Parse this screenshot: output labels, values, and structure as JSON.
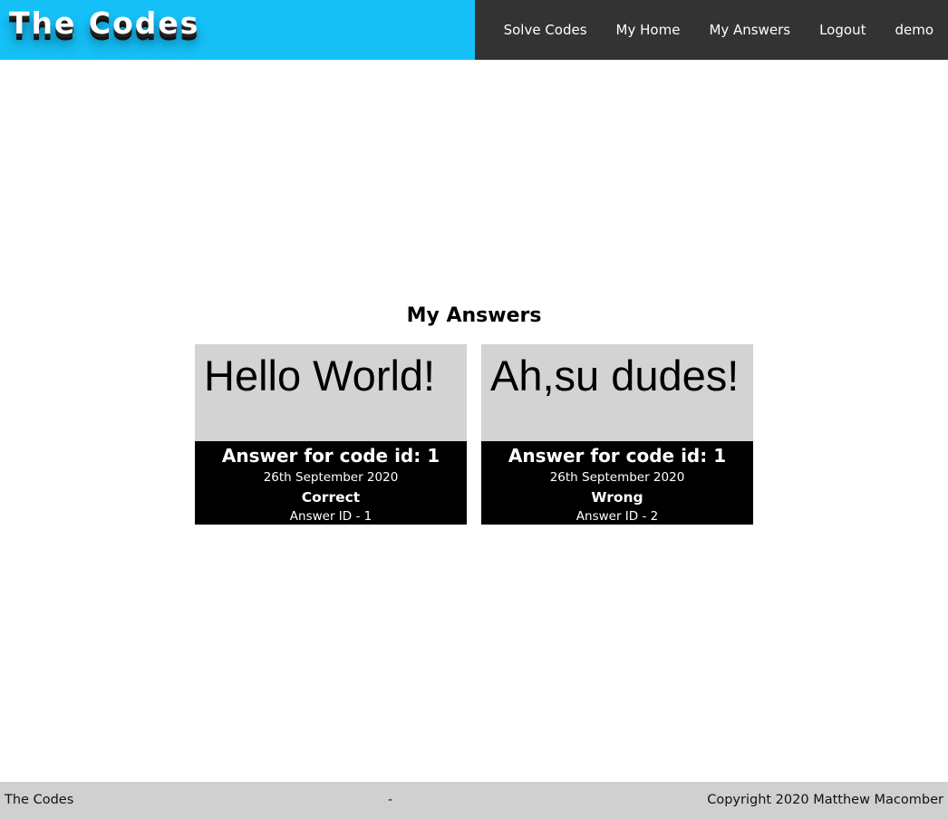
{
  "header": {
    "brand": "The Codes",
    "brand_color": "#15c0f7",
    "nav_color": "#333333",
    "nav": [
      {
        "label": "Solve Codes"
      },
      {
        "label": "My Home"
      },
      {
        "label": "My Answers"
      },
      {
        "label": "Logout"
      },
      {
        "label": "demo"
      }
    ]
  },
  "main": {
    "title": "My Answers",
    "cards": [
      {
        "answer": "Hello World!",
        "heading": "Answer for code id: 1",
        "date": "26th September 2020",
        "result": "Correct",
        "answer_id": "Answer ID - 1"
      },
      {
        "answer": "Ah,su dudes!",
        "heading": "Answer for code id: 1",
        "date": "26th September 2020",
        "result": "Wrong",
        "answer_id": "Answer ID - 2"
      }
    ]
  },
  "footer": {
    "left": "The Codes",
    "separator": "-",
    "right": "Copyright 2020 Matthew Macomber"
  }
}
